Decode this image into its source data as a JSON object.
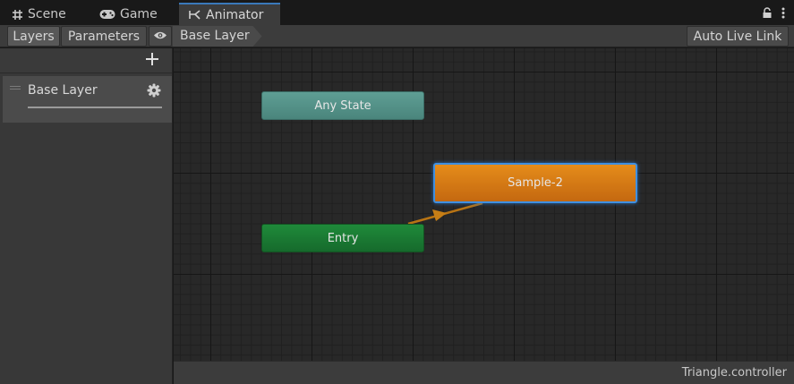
{
  "tabs": [
    {
      "label": "Scene",
      "icon": "hash-icon"
    },
    {
      "label": "Game",
      "icon": "gamepad-icon"
    },
    {
      "label": "Animator",
      "icon": "animator-icon",
      "active": true
    }
  ],
  "toolbar": {
    "layers_label": "Layers",
    "parameters_label": "Parameters",
    "eye_icon": "eye-icon",
    "breadcrumb": [
      "Base Layer"
    ],
    "auto_live_link_label": "Auto Live Link"
  },
  "layers_panel": {
    "add_icon": "plus-icon",
    "layers": [
      {
        "name": "Base Layer",
        "settings_icon": "gear-icon"
      }
    ]
  },
  "graph": {
    "states": {
      "any_state": "Any State",
      "entry": "Entry",
      "sample": "Sample-2"
    }
  },
  "status": {
    "file": "Triangle.controller"
  },
  "colors": {
    "accent": "#3a79bb",
    "any_state": "#5e9e94",
    "entry": "#1f8a3a",
    "default_state": "#e58c1a",
    "transition": "#c07a14"
  }
}
